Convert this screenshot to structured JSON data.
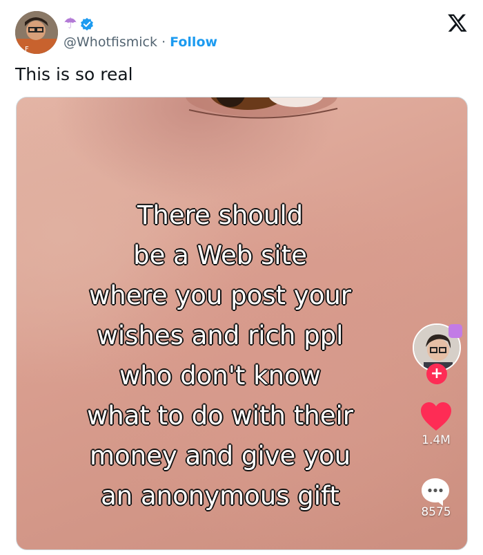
{
  "post": {
    "handle": "@Whotfismick",
    "separator": "·",
    "follow_label": "Follow",
    "text": "This is so real"
  },
  "media": {
    "overlay_lines": [
      "There should",
      "be a Web site",
      "where you post your",
      "wishes and rich ppl",
      "who don't know",
      "what to do with their",
      "money and give you",
      "an anonymous gift"
    ],
    "likes_count": "1.4M",
    "comments_count": "8575"
  },
  "colors": {
    "accent": "#1d9bf0",
    "like": "#fe2c55",
    "text": "#0f1419",
    "secondary": "#536471"
  },
  "icons": [
    "umbrella-icon",
    "verified-badge-icon",
    "x-logo-icon",
    "heart-icon",
    "comment-icon",
    "plus-icon"
  ]
}
